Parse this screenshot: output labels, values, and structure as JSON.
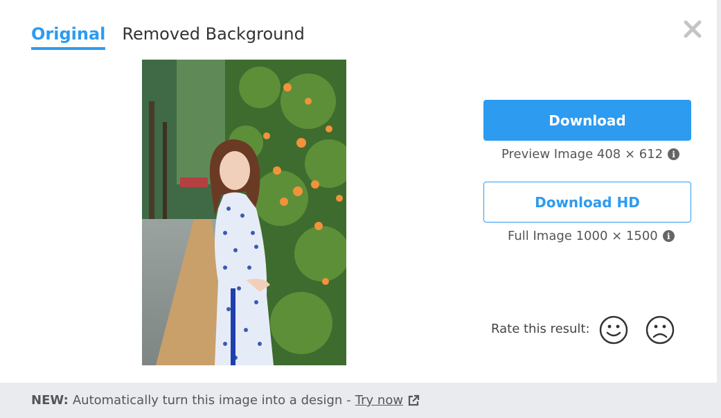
{
  "tabs": [
    {
      "label": "Original",
      "active": true
    },
    {
      "label": "Removed Background",
      "active": false
    }
  ],
  "close": {
    "icon": "close-icon"
  },
  "actions": {
    "download_label": "Download",
    "preview_caption": "Preview Image 408 × 612",
    "download_hd_label": "Download HD",
    "full_caption": "Full Image 1000 × 1500",
    "info_icon": "info-icon"
  },
  "rating": {
    "label": "Rate this result:",
    "positive_icon": "happy-face-icon",
    "negative_icon": "sad-face-icon"
  },
  "footer": {
    "new_label": "NEW:",
    "text": "Automatically turn this image into a design",
    "separator": "-",
    "link_label": "Try now",
    "link_icon": "external-link-icon"
  },
  "colors": {
    "accent": "#2d9bf0",
    "footer_bg": "#e9ebee"
  }
}
